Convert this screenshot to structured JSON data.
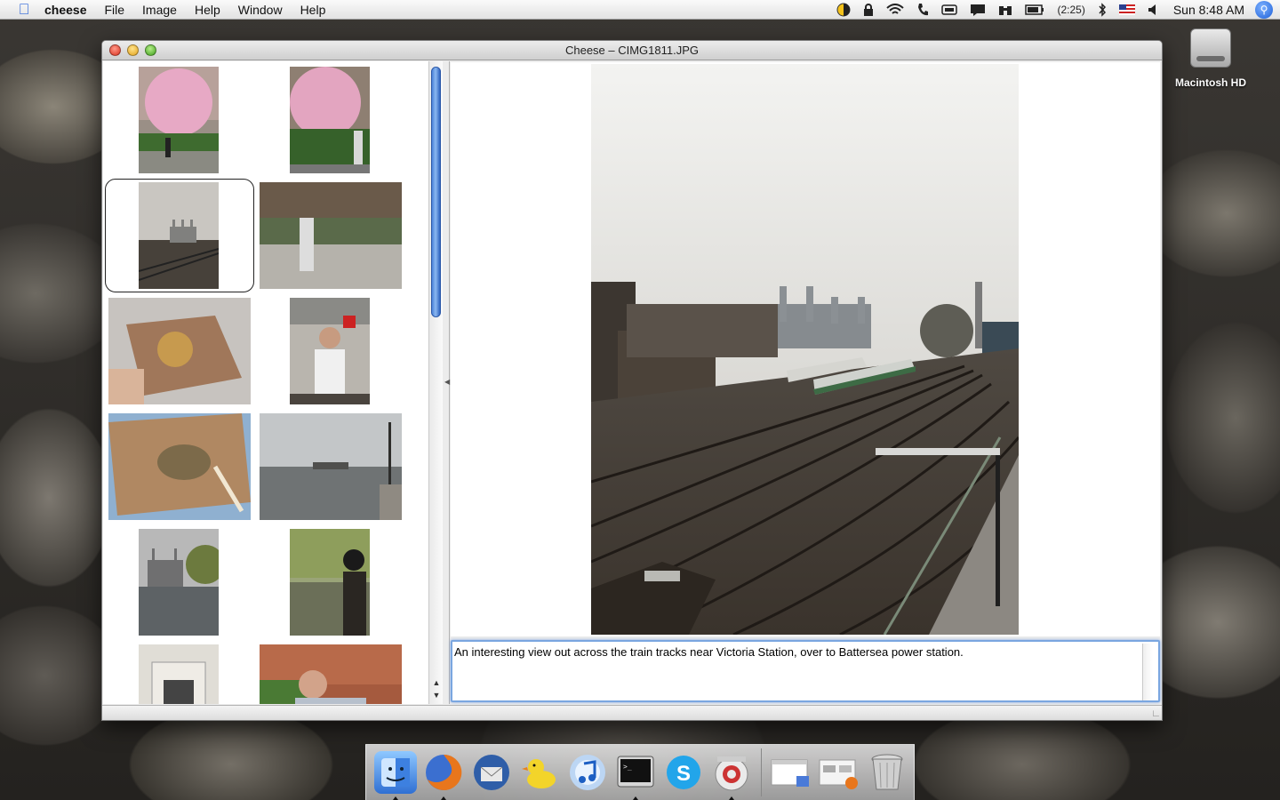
{
  "menubar": {
    "app_name": "cheese",
    "menus": [
      "File",
      "Image",
      "Help",
      "Window",
      "Help"
    ],
    "battery": "(2:25)",
    "clock": "Sun 8:48 AM"
  },
  "desktop": {
    "drive_label": "Macintosh HD"
  },
  "window": {
    "title": "Cheese – CIMG1811.JPG",
    "caption_text": "An interesting view out across the train tracks near Victoria Station, over to Battersea power station.",
    "thumbnails": [
      {
        "name": "cherry-blossom-woman",
        "selected": false
      },
      {
        "name": "cherry-blossom-man",
        "selected": false
      },
      {
        "name": "battersea-tracks",
        "selected": true
      },
      {
        "name": "market-man",
        "selected": false
      },
      {
        "name": "pie-box",
        "selected": false
      },
      {
        "name": "man-eating",
        "selected": false
      },
      {
        "name": "food-box",
        "selected": false
      },
      {
        "name": "river-view",
        "selected": false
      },
      {
        "name": "battersea-river",
        "selected": false
      },
      {
        "name": "woman-tree",
        "selected": false
      },
      {
        "name": "building-entrance",
        "selected": false
      },
      {
        "name": "man-tired",
        "selected": false
      }
    ]
  },
  "dock": {
    "items": [
      "finder",
      "firefox",
      "thunderbird",
      "cyberduck",
      "itunes",
      "terminal",
      "skype",
      "kenshō",
      "preview-stack",
      "documents-stack",
      "trash"
    ]
  }
}
